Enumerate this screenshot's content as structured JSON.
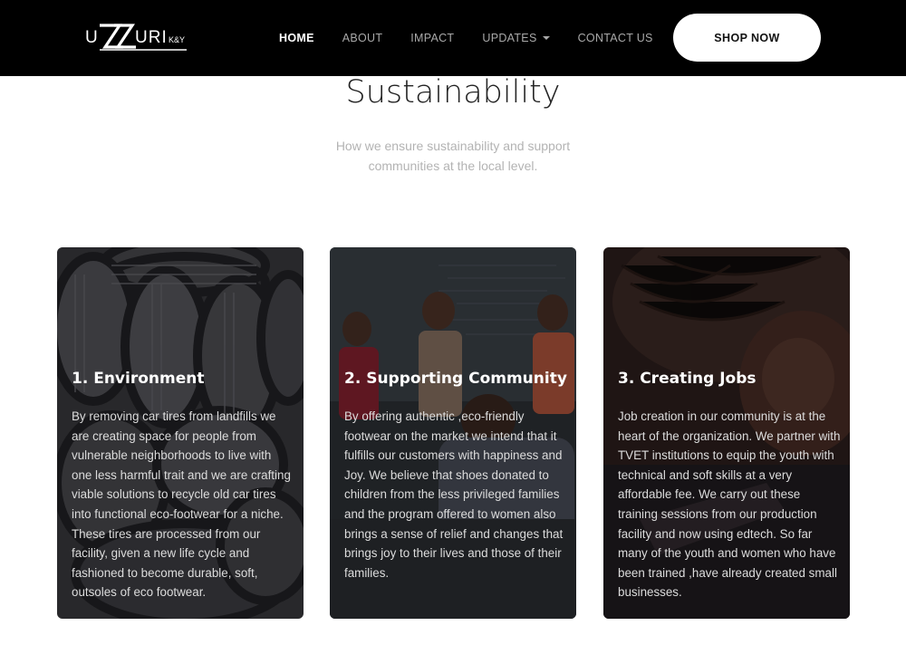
{
  "header": {
    "logo_text": "UZURI K&Y",
    "nav": [
      {
        "label": "HOME",
        "active": true
      },
      {
        "label": "ABOUT",
        "active": false
      },
      {
        "label": "IMPACT",
        "active": false
      },
      {
        "label": "UPDATES",
        "active": false,
        "dropdown": true
      },
      {
        "label": "CONTACT US",
        "active": false
      }
    ],
    "cta_label": "SHOP NOW"
  },
  "section": {
    "title": "Sustainability",
    "subtitle": "How we ensure sustainability and support communities at the local level."
  },
  "cards": [
    {
      "title": "1. Environment",
      "text": "By removing car tires from landfills we are creating space for people from vulnerable neighborhoods to live with one less harmful trait and we are crafting viable solutions to recycle old car tires into functional eco-footwear for a niche. These tires are processed from our facility, given a new life cycle and fashioned to become durable, soft, outsoles of eco footwear.",
      "image": "stacked-car-tires"
    },
    {
      "title": "2. Supporting Community",
      "text": "By offering authentic ,eco-friendly footwear on the market we intend that it fulfills our customers with happiness and Joy. We believe that shoes donated to children from the less privileged families and the program offered to women also brings a sense of relief and changes that brings joy to their lives and those of their families.",
      "image": "children-in-classroom"
    },
    {
      "title": "3. Creating Jobs",
      "text": "Job creation in our community is at the heart of the organization. We partner with TVET institutions to equip the youth with technical and soft skills at a very affordable fee. We carry out these training sessions from our production facility and now using edtech. So far many of the youth and women who have been trained ,have already created small businesses.",
      "image": "woman-working"
    }
  ],
  "colors": {
    "header_bg": "#000000",
    "nav_active": "#ffffff",
    "nav_inactive": "#a9a9a9",
    "cta_bg": "#ffffff"
  }
}
